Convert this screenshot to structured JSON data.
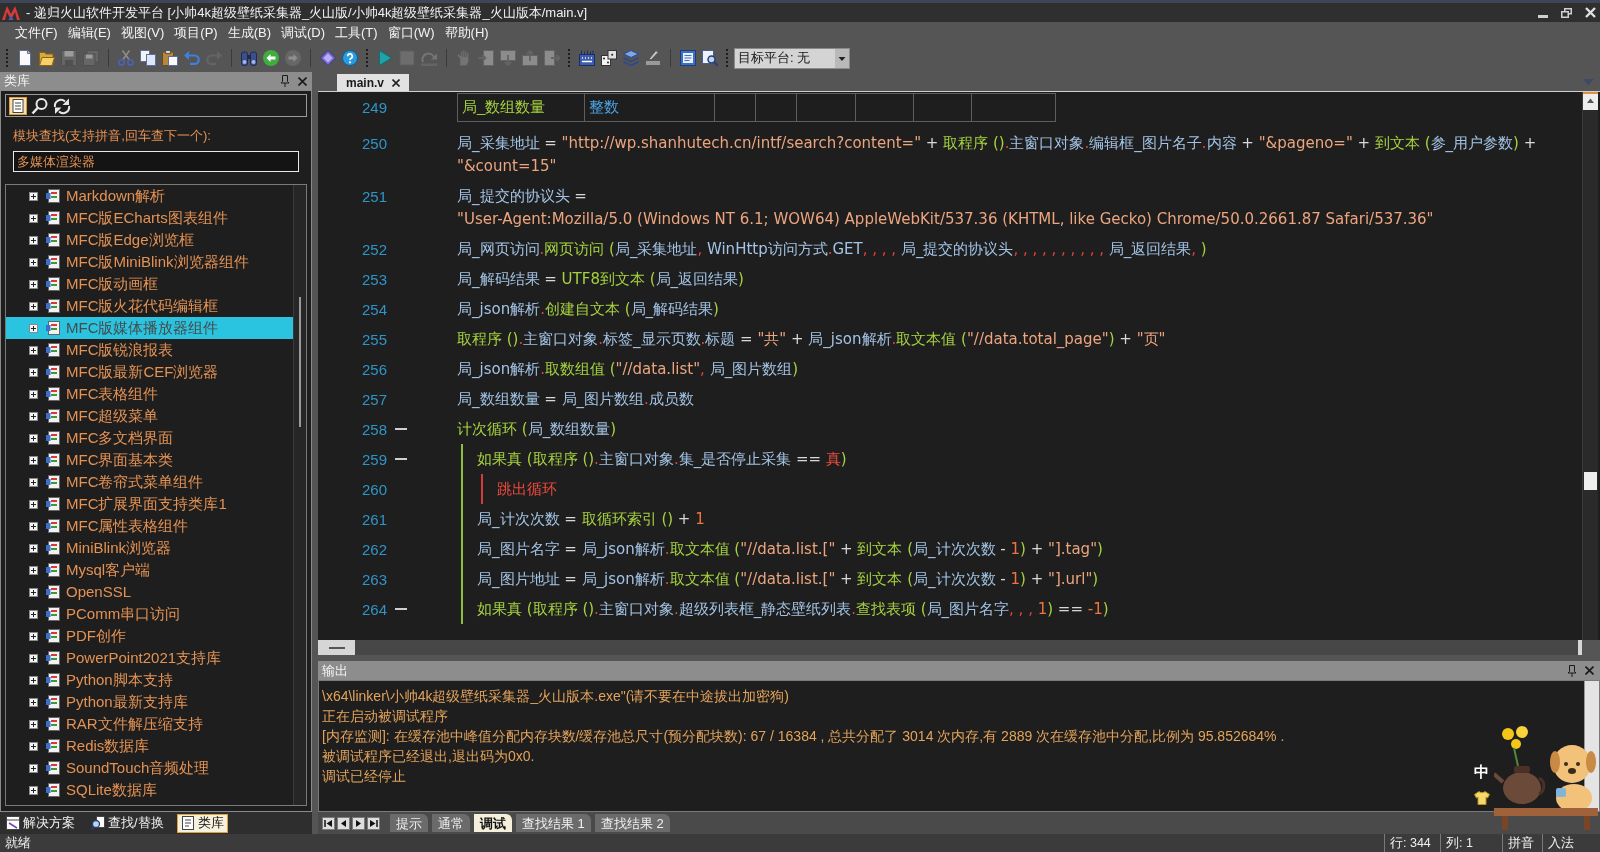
{
  "window": {
    "title": "- 递归火山软件开发平台 [小帅4k超级壁纸采集器_火山版/小帅4k超级壁纸采集器_火山版本/main.v]"
  },
  "menu": [
    "文件(F)",
    "编辑(E)",
    "视图(V)",
    "项目(P)",
    "生成(B)",
    "调试(D)",
    "工具(T)",
    "窗口(W)",
    "帮助(H)"
  ],
  "toolbar": {
    "buttons": [
      {
        "disabled": false
      },
      {
        "disabled": false
      },
      {
        "disabled": true
      },
      {
        "disabled": true
      },
      {
        "disabled": false
      },
      {
        "disabled": false
      },
      {
        "disabled": false
      },
      {
        "disabled": false
      },
      {
        "disabled": true
      },
      {
        "disabled": false
      },
      {
        "disabled": false
      },
      {
        "disabled": true
      },
      {
        "disabled": false
      },
      {
        "disabled": false
      },
      {
        "disabled": false
      },
      {
        "disabled": true
      },
      {
        "disabled": true
      },
      {
        "disabled": true
      },
      {
        "disabled": true
      },
      {
        "disabled": true
      },
      {
        "disabled": true
      },
      {
        "disabled": true
      },
      {
        "disabled": false
      },
      {
        "disabled": false
      },
      {
        "disabled": false
      },
      {
        "disabled": false
      },
      {
        "disabled": false
      },
      {
        "disabled": false
      }
    ],
    "target_platform": "目标平台: 无"
  },
  "library_panel": {
    "title": "类库",
    "tools": [
      {
        "selected": true
      },
      {
        "selected": false
      },
      {
        "selected": false
      }
    ],
    "search_label": "模块查找(支持拼音,回车查下一个):",
    "search": {
      "value": "多媒体渲染器"
    },
    "items": [
      {
        "label": "Markdown解析",
        "expanded": false,
        "selected": false
      },
      {
        "label": "MFC版ECharts图表组件",
        "expanded": false,
        "selected": false
      },
      {
        "label": "MFC版Edge浏览框",
        "expanded": false,
        "selected": false
      },
      {
        "label": "MFC版MiniBlink浏览器组件",
        "expanded": false,
        "selected": false
      },
      {
        "label": "MFC版动画框",
        "expanded": false,
        "selected": false
      },
      {
        "label": "MFC版火花代码编辑框",
        "expanded": false,
        "selected": false
      },
      {
        "label": "MFC版媒体播放器组件",
        "expanded": false,
        "selected": true
      },
      {
        "label": "MFC版锐浪报表",
        "expanded": false,
        "selected": false
      },
      {
        "label": "MFC版最新CEF浏览器",
        "expanded": false,
        "selected": false
      },
      {
        "label": "MFC表格组件",
        "expanded": false,
        "selected": false
      },
      {
        "label": "MFC超级菜单",
        "expanded": false,
        "selected": false
      },
      {
        "label": "MFC多文档界面",
        "expanded": false,
        "selected": false
      },
      {
        "label": "MFC界面基本类",
        "expanded": false,
        "selected": false
      },
      {
        "label": "MFC卷帘式菜单组件",
        "expanded": false,
        "selected": false
      },
      {
        "label": "MFC扩展界面支持类库1",
        "expanded": false,
        "selected": false
      },
      {
        "label": "MFC属性表格组件",
        "expanded": false,
        "selected": false
      },
      {
        "label": "MiniBlink浏览器",
        "expanded": false,
        "selected": false
      },
      {
        "label": "Mysql客户端",
        "expanded": false,
        "selected": false
      },
      {
        "label": "OpenSSL",
        "expanded": false,
        "selected": false
      },
      {
        "label": "PComm串口访问",
        "expanded": false,
        "selected": false
      },
      {
        "label": "PDF创作",
        "expanded": false,
        "selected": false
      },
      {
        "label": "PowerPoint2021支持库",
        "expanded": false,
        "selected": false
      },
      {
        "label": "Python脚本支持",
        "expanded": false,
        "selected": false
      },
      {
        "label": "Python最新支持库",
        "expanded": false,
        "selected": false
      },
      {
        "label": "RAR文件解压缩支持",
        "expanded": false,
        "selected": false
      },
      {
        "label": "Redis数据库",
        "expanded": false,
        "selected": false
      },
      {
        "label": "SoundTouch音频处理",
        "expanded": false,
        "selected": false
      },
      {
        "label": "SQLite数据库",
        "expanded": false,
        "selected": false
      }
    ],
    "tabs": [
      {
        "label": "解决方案",
        "selected": false
      },
      {
        "label": "查找/替换",
        "selected": false
      },
      {
        "label": "类库",
        "selected": true
      }
    ]
  },
  "editor": {
    "tabs": [
      {
        "label": "main.v",
        "selected": true
      }
    ],
    "lines": [
      {
        "number": "249",
        "kind": "table",
        "cells": [
          {
            "text": "局_数组数量",
            "kind": "name"
          },
          {
            "text": "整数",
            "kind": "type"
          }
        ]
      },
      {
        "number": "250",
        "kind": "code",
        "tokens": [
          {
            "text": "局_采集地址",
            "kind": "var"
          },
          {
            "text": " = ",
            "kind": "op"
          },
          {
            "text": "\"http://wp.shanhutech.cn/intf/search?content=\"",
            "kind": "str"
          },
          {
            "text": " + ",
            "kind": "op"
          },
          {
            "text": "取程序 ()",
            "kind": "call"
          },
          {
            "text": ".",
            "kind": "sep"
          },
          {
            "text": "主窗口对象",
            "kind": "var"
          },
          {
            "text": ".",
            "kind": "sep"
          },
          {
            "text": "编辑框_图片名子",
            "kind": "var"
          },
          {
            "text": ".",
            "kind": "sep"
          },
          {
            "text": "内容",
            "kind": "var"
          },
          {
            "text": " + ",
            "kind": "op"
          },
          {
            "text": "\"&pageno=\"",
            "kind": "str"
          },
          {
            "text": " + ",
            "kind": "op"
          },
          {
            "text": "到文本 (",
            "kind": "call"
          },
          {
            "text": "参_用户参数",
            "kind": "var"
          },
          {
            "text": ")",
            "kind": "call"
          },
          {
            "text": " + ",
            "kind": "op"
          },
          {
            "text": "\"&count=15\"",
            "kind": "str"
          }
        ]
      },
      {
        "number": "251",
        "kind": "code",
        "tokens": [
          {
            "text": "局_提交的协议头",
            "kind": "var"
          },
          {
            "text": " = ",
            "kind": "op"
          },
          {
            "text": "\"User-Agent:Mozilla/5.0 (Windows NT 6.1; WOW64) AppleWebKit/537.36 (KHTML, like Gecko) Chrome/50.0.2661.87 Safari/537.36\"",
            "kind": "str"
          }
        ]
      },
      {
        "number": "252",
        "kind": "code",
        "tokens": [
          {
            "text": "局_网页访问",
            "kind": "var"
          },
          {
            "text": ".",
            "kind": "sep"
          },
          {
            "text": "网页访问 (",
            "kind": "call"
          },
          {
            "text": "局_采集地址",
            "kind": "var"
          },
          {
            "text": ", ",
            "kind": "sep"
          },
          {
            "text": "WinHttp访问方式",
            "kind": "var"
          },
          {
            "text": ".",
            "kind": "sep"
          },
          {
            "text": "GET",
            "kind": "var"
          },
          {
            "text": ", , , , ",
            "kind": "sep"
          },
          {
            "text": "局_提交的协议头",
            "kind": "var"
          },
          {
            "text": ", , , , , , , , , , ",
            "kind": "sep"
          },
          {
            "text": "局_返回结果",
            "kind": "var"
          },
          {
            "text": ", ",
            "kind": "sep"
          },
          {
            "text": ")",
            "kind": "call"
          }
        ]
      },
      {
        "number": "253",
        "kind": "code",
        "tokens": [
          {
            "text": "局_解码结果",
            "kind": "var"
          },
          {
            "text": " = ",
            "kind": "op"
          },
          {
            "text": "UTF8到文本 (",
            "kind": "call"
          },
          {
            "text": "局_返回结果",
            "kind": "var"
          },
          {
            "text": ")",
            "kind": "call"
          }
        ]
      },
      {
        "number": "254",
        "kind": "code",
        "tokens": [
          {
            "text": "局_json解析",
            "kind": "var"
          },
          {
            "text": ".",
            "kind": "sep"
          },
          {
            "text": "创建自文本 (",
            "kind": "call"
          },
          {
            "text": "局_解码结果",
            "kind": "var"
          },
          {
            "text": ")",
            "kind": "call"
          }
        ]
      },
      {
        "number": "255",
        "kind": "code",
        "tokens": [
          {
            "text": "取程序 ()",
            "kind": "call"
          },
          {
            "text": ".",
            "kind": "sep"
          },
          {
            "text": "主窗口对象",
            "kind": "var"
          },
          {
            "text": ".",
            "kind": "sep"
          },
          {
            "text": "标签_显示页数",
            "kind": "var"
          },
          {
            "text": ".",
            "kind": "sep"
          },
          {
            "text": "标题",
            "kind": "var"
          },
          {
            "text": " = ",
            "kind": "op"
          },
          {
            "text": "\"共\"",
            "kind": "str"
          },
          {
            "text": " + ",
            "kind": "op"
          },
          {
            "text": "局_json解析",
            "kind": "var"
          },
          {
            "text": ".",
            "kind": "sep"
          },
          {
            "text": "取文本值 (",
            "kind": "call"
          },
          {
            "text": "\"//data.total_page\"",
            "kind": "str"
          },
          {
            "text": ")",
            "kind": "call"
          },
          {
            "text": " + ",
            "kind": "op"
          },
          {
            "text": "\"页\"",
            "kind": "str"
          }
        ]
      },
      {
        "number": "256",
        "kind": "code",
        "tokens": [
          {
            "text": "局_json解析",
            "kind": "var"
          },
          {
            "text": ".",
            "kind": "sep"
          },
          {
            "text": "取数组值 (",
            "kind": "call"
          },
          {
            "text": "\"//data.list\"",
            "kind": "str"
          },
          {
            "text": ", ",
            "kind": "sep"
          },
          {
            "text": "局_图片数组",
            "kind": "var"
          },
          {
            "text": ")",
            "kind": "call"
          }
        ]
      },
      {
        "number": "257",
        "kind": "code",
        "tokens": [
          {
            "text": "局_数组数量",
            "kind": "var"
          },
          {
            "text": " = ",
            "kind": "op"
          },
          {
            "text": "局_图片数组",
            "kind": "var"
          },
          {
            "text": ".",
            "kind": "sep"
          },
          {
            "text": "成员数",
            "kind": "var"
          }
        ]
      },
      {
        "number": "258",
        "kind": "code",
        "expanded": true,
        "color": "#8cbf3f",
        "tokens": [
          {
            "text": "计次循环 (",
            "kind": "call"
          },
          {
            "text": "局_数组数量",
            "kind": "var"
          },
          {
            "text": ")",
            "kind": "call"
          }
        ],
        "children": [
          {
            "number": "259",
            "kind": "code",
            "expanded": true,
            "color": "#d23c3c",
            "tokens": [
              {
                "text": "如果真 (",
                "kind": "call"
              },
              {
                "text": "取程序 ()",
                "kind": "call"
              },
              {
                "text": ".",
                "kind": "sep"
              },
              {
                "text": "主窗口对象",
                "kind": "var"
              },
              {
                "text": ".",
                "kind": "sep"
              },
              {
                "text": "集_是否停止采集",
                "kind": "var"
              },
              {
                "text": " == ",
                "kind": "op"
              },
              {
                "text": "真",
                "kind": "kw"
              },
              {
                "text": ")",
                "kind": "call"
              }
            ],
            "children": [
              {
                "number": "260",
                "kind": "code",
                "tokens": [
                  {
                    "text": "跳出循环",
                    "kind": "kw"
                  }
                ]
              }
            ]
          },
          {
            "number": "261",
            "kind": "code",
            "tokens": [
              {
                "text": "局_计次次数",
                "kind": "var"
              },
              {
                "text": " = ",
                "kind": "op"
              },
              {
                "text": "取循环索引 ()",
                "kind": "call"
              },
              {
                "text": " + ",
                "kind": "op"
              },
              {
                "text": "1",
                "kind": "num"
              }
            ]
          },
          {
            "number": "262",
            "kind": "code",
            "tokens": [
              {
                "text": "局_图片名字",
                "kind": "var"
              },
              {
                "text": " = ",
                "kind": "op"
              },
              {
                "text": "局_json解析",
                "kind": "var"
              },
              {
                "text": ".",
                "kind": "sep"
              },
              {
                "text": "取文本值 (",
                "kind": "call"
              },
              {
                "text": "\"//data.list.[\"",
                "kind": "str"
              },
              {
                "text": " + ",
                "kind": "op"
              },
              {
                "text": "到文本 (",
                "kind": "call"
              },
              {
                "text": "局_计次次数",
                "kind": "var"
              },
              {
                "text": " - ",
                "kind": "op"
              },
              {
                "text": "1",
                "kind": "num"
              },
              {
                "text": ")",
                "kind": "call"
              },
              {
                "text": " + ",
                "kind": "op"
              },
              {
                "text": "\"].tag\"",
                "kind": "str"
              },
              {
                "text": ")",
                "kind": "call"
              }
            ]
          },
          {
            "number": "263",
            "kind": "code",
            "tokens": [
              {
                "text": "局_图片地址",
                "kind": "var"
              },
              {
                "text": " = ",
                "kind": "op"
              },
              {
                "text": "局_json解析",
                "kind": "var"
              },
              {
                "text": ".",
                "kind": "sep"
              },
              {
                "text": "取文本值 (",
                "kind": "call"
              },
              {
                "text": "\"//data.list.[\"",
                "kind": "str"
              },
              {
                "text": " + ",
                "kind": "op"
              },
              {
                "text": "到文本 (",
                "kind": "call"
              },
              {
                "text": "局_计次次数",
                "kind": "var"
              },
              {
                "text": " - ",
                "kind": "op"
              },
              {
                "text": "1",
                "kind": "num"
              },
              {
                "text": ")",
                "kind": "call"
              },
              {
                "text": " + ",
                "kind": "op"
              },
              {
                "text": "\"].url\"",
                "kind": "str"
              },
              {
                "text": ")",
                "kind": "call"
              }
            ]
          },
          {
            "number": "264",
            "kind": "code",
            "expanded": true,
            "tokens": [
              {
                "text": "如果真 (",
                "kind": "call"
              },
              {
                "text": "取程序 ()",
                "kind": "call"
              },
              {
                "text": ".",
                "kind": "sep"
              },
              {
                "text": "主窗口对象",
                "kind": "var"
              },
              {
                "text": ".",
                "kind": "sep"
              },
              {
                "text": "超级列表框_静态壁纸列表",
                "kind": "var"
              },
              {
                "text": ".",
                "kind": "sep"
              },
              {
                "text": "查找表项 (",
                "kind": "call"
              },
              {
                "text": "局_图片名字",
                "kind": "var"
              },
              {
                "text": ", , , ",
                "kind": "sep"
              },
              {
                "text": "1",
                "kind": "num"
              },
              {
                "text": ")",
                "kind": "call"
              },
              {
                "text": " == ",
                "kind": "op"
              },
              {
                "text": "-1",
                "kind": "num"
              },
              {
                "text": ")",
                "kind": "call"
              }
            ]
          }
        ]
      }
    ]
  },
  "output_panel": {
    "title": "输出",
    "lines": [
      "\\x64\\linker\\小帅4k超级壁纸采集器_火山版本.exe\"(请不要在中途拔出加密狗)",
      "正在启动被调试程序",
      "[内存监测]: 在缓存池中峰值分配内存块数/缓存池总尺寸(预分配块数): 67 / 16384 , 总共分配了 3014 次内存,有 2889 次在缓存池中分配,比例为 95.852684% .",
      "被调试程序已经退出,退出码为0x0.",
      "调试已经停止"
    ],
    "tabs": [
      {
        "label": "提示",
        "selected": false
      },
      {
        "label": "通常",
        "selected": false
      },
      {
        "label": "调试",
        "selected": true
      },
      {
        "label": "查找结果 1",
        "selected": false
      },
      {
        "label": "查找结果 2",
        "selected": false
      }
    ]
  },
  "status_bar": {
    "message": "就绪",
    "fields": [
      "行: 344",
      "列: 1",
      "拼音",
      "入法"
    ]
  },
  "ime_overlay": {
    "mode": "中"
  }
}
